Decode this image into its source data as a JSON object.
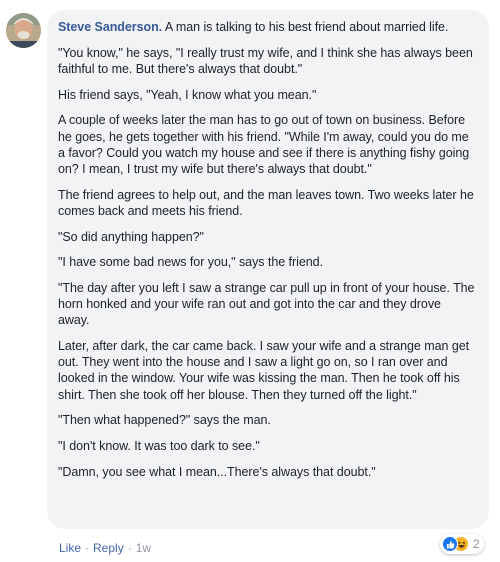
{
  "comment": {
    "author": "Steve Sanderson.",
    "paragraphs": [
      " A man is talking to his best friend about married life.",
      "\"You know,\" he says, \"I really trust my wife, and I think she has always been faithful to me. But there's always that doubt.\"",
      "His friend says, \"Yeah, I know what you mean.\"",
      "A couple of weeks later the man has to go out of town on business. Before he goes, he gets together with his friend. \"While I'm away, could you do me a favor? Could you watch my house and see if there is anything fishy going on? I mean, I trust my wife but there's always that doubt.\"",
      "The friend agrees to help out, and the man leaves town. Two weeks later he comes back and meets his friend.",
      "\"So did anything happen?\"",
      "\"I have some bad news for you,\" says the friend.",
      "\"The day after you left I saw a strange car pull up in front of your house. The horn honked and your wife ran out and got into the car and they drove away.",
      "Later, after dark, the car came back. I saw your wife and a strange man get out. They went into the house and I saw a light go on, so I ran over and looked in the window. Your wife was kissing the man. Then he took off his shirt. Then she took off her blouse. Then they turned off the light.\"",
      "\"Then what happened?\" says the man.",
      "\"I don't know. It was too dark to see.\"",
      "\"Damn, you see what I mean...There's always that doubt.\""
    ]
  },
  "reactions": {
    "icons": [
      "like-icon",
      "haha-icon"
    ],
    "count": "2",
    "colors": {
      "like": "#1877f2",
      "haha": "#f7b125"
    }
  },
  "actions": {
    "like_label": "Like",
    "reply_label": "Reply",
    "separator": "·",
    "time": "1w"
  },
  "colors": {
    "bubble": "#f2f3f5",
    "author": "#385898",
    "link": "#4267b2",
    "meta": "#90949c"
  }
}
